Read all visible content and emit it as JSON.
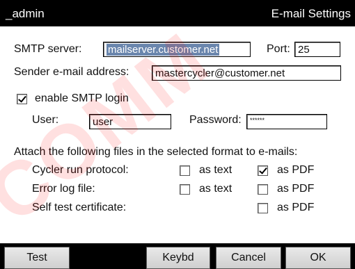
{
  "header": {
    "user": "_admin",
    "title": "E-mail Settings"
  },
  "smtp": {
    "server_label": "SMTP server:",
    "server_value": "mailserver.customer.net",
    "port_label": "Port:",
    "port_value": "25",
    "sender_label": "Sender e-mail address:",
    "sender_value": "mastercycler@customer.net",
    "login_label": "enable SMTP login",
    "login_checked": true,
    "user_label": "User:",
    "user_value": "user",
    "password_label": "Password:",
    "password_value": "******"
  },
  "attach": {
    "heading": "Attach the following files in the selected format to e-mails:",
    "rows": [
      {
        "label": "Cycler run protocol:",
        "text_label": "as text",
        "text_checked": false,
        "pdf_label": "as PDF",
        "pdf_checked": true
      },
      {
        "label": "Error log file:",
        "text_label": "as text",
        "text_checked": false,
        "pdf_label": "as PDF",
        "pdf_checked": false
      },
      {
        "label": "Self test certificate:",
        "pdf_label": "as PDF",
        "pdf_checked": false
      }
    ]
  },
  "buttons": {
    "test": "Test",
    "keybd": "Keybd",
    "cancel": "Cancel",
    "ok": "OK"
  },
  "watermark": "COMM"
}
